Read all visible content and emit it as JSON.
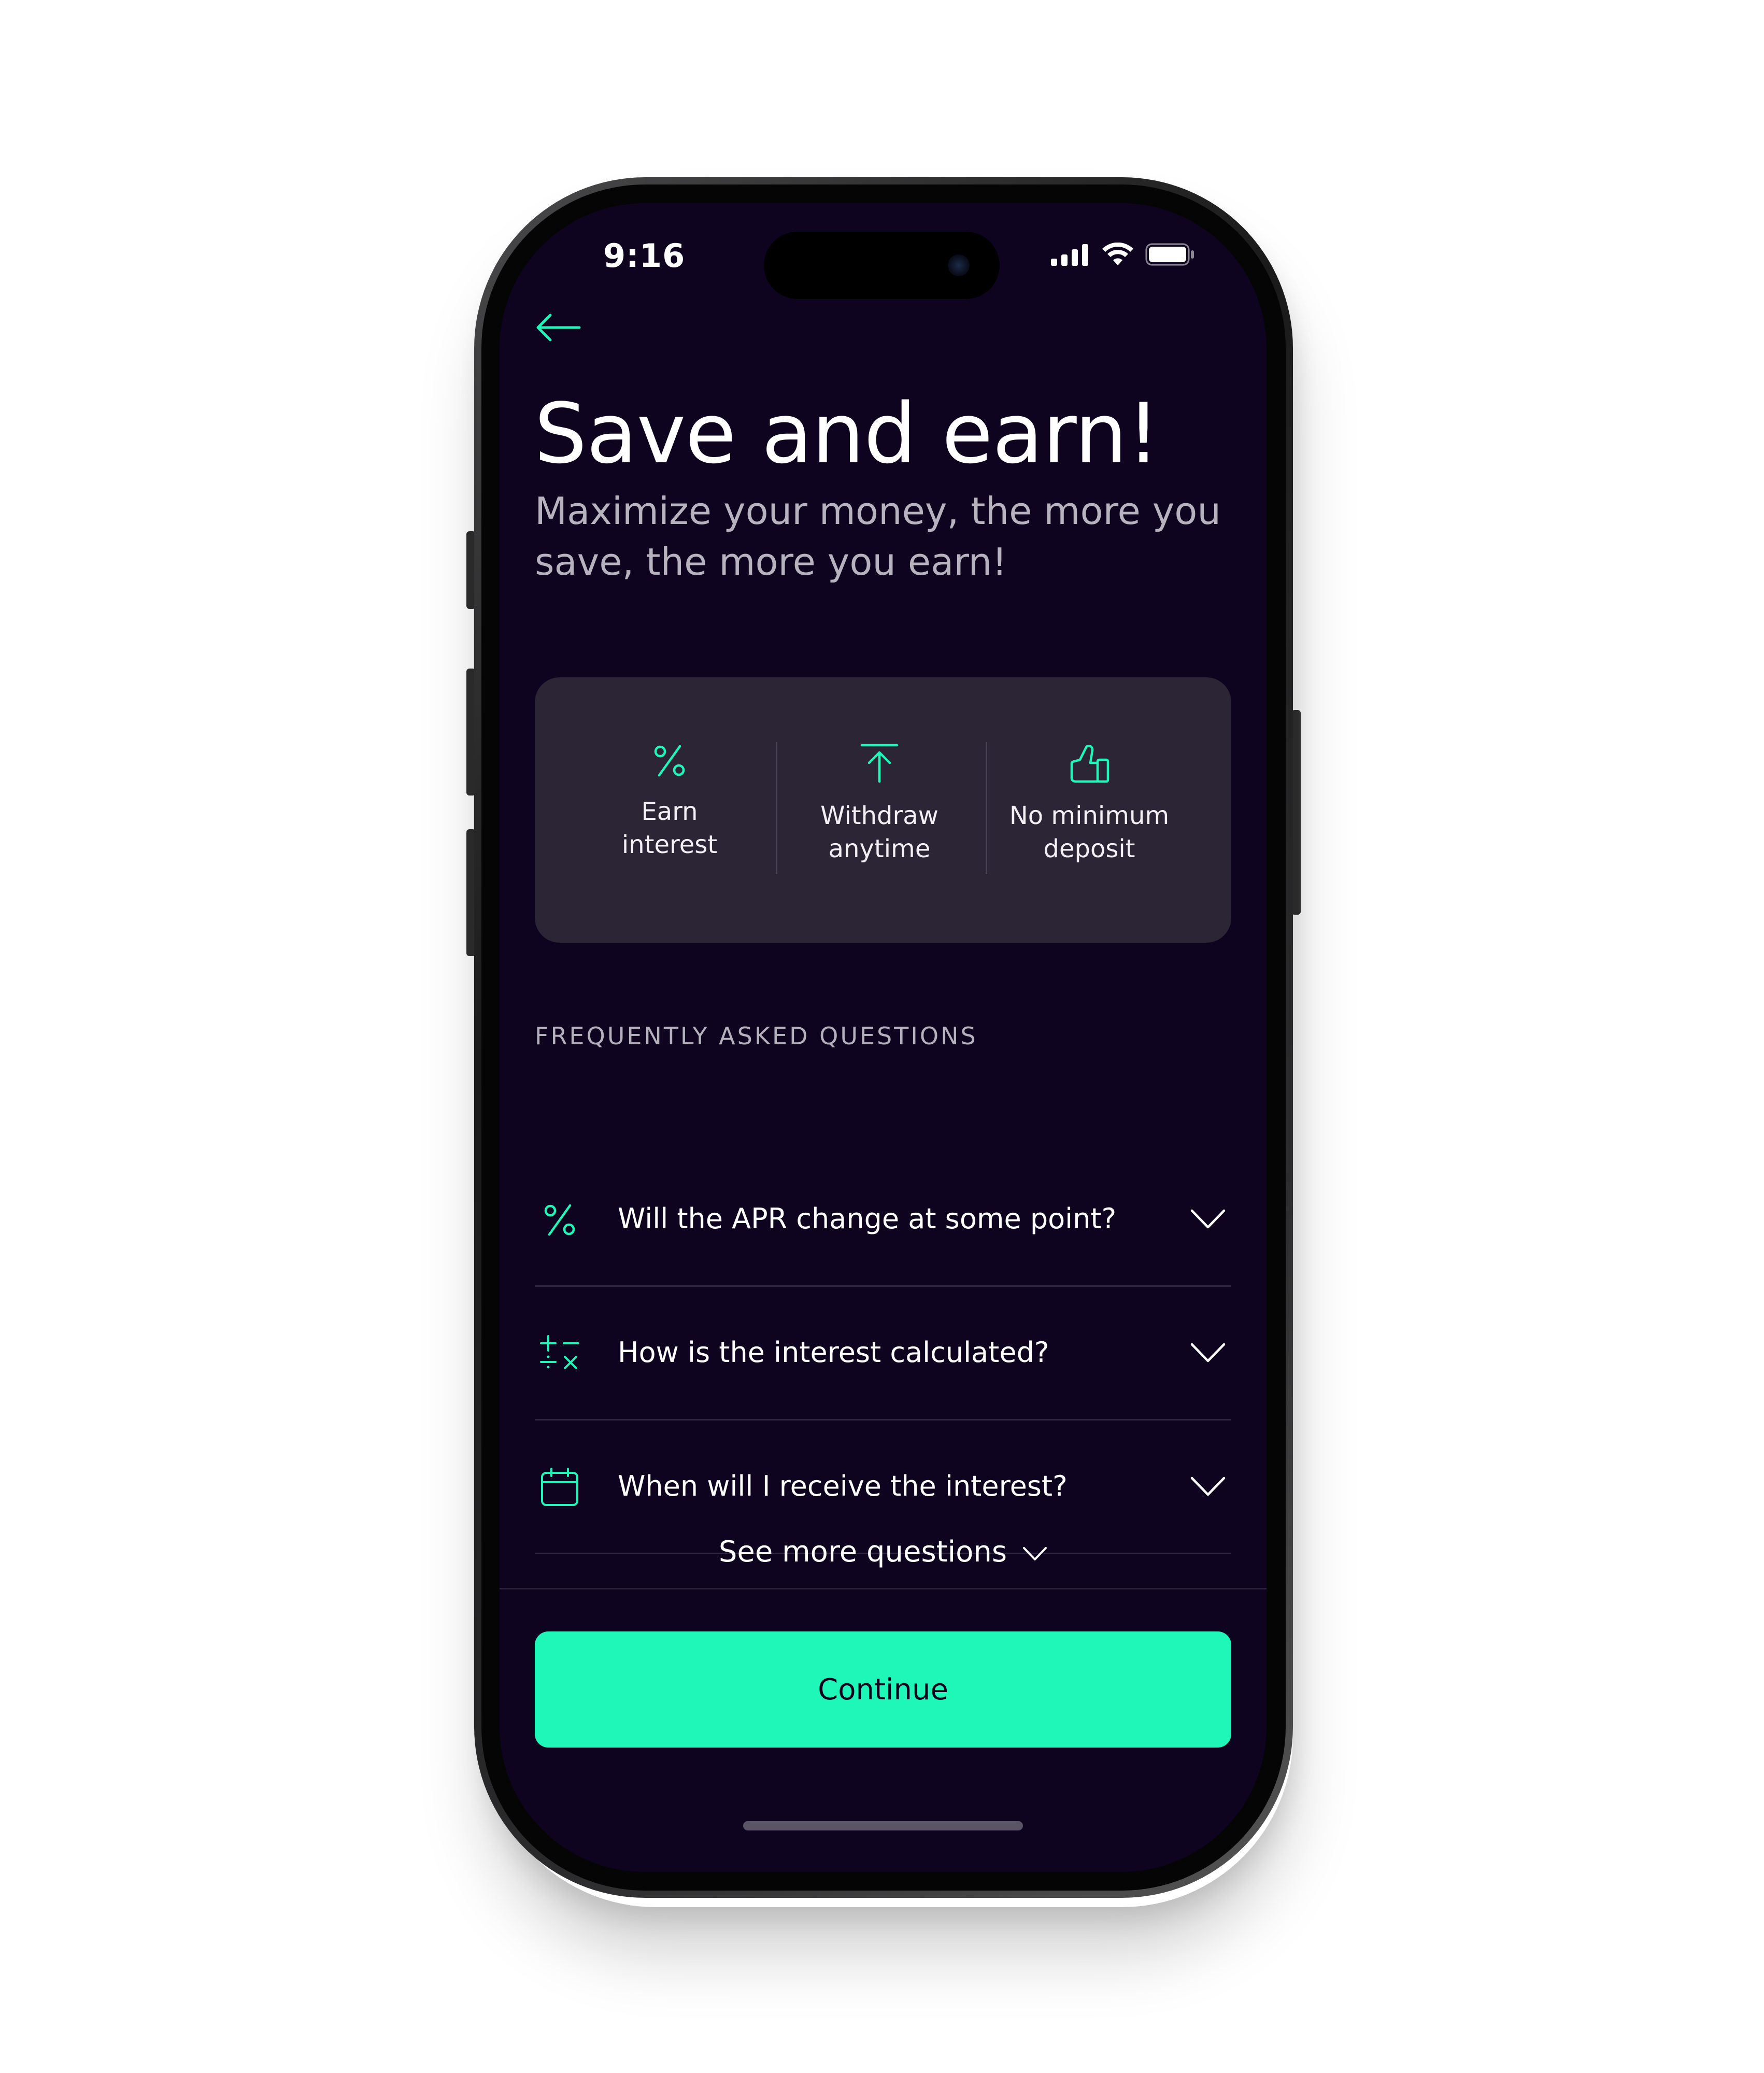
{
  "status_bar": {
    "time": "9:16",
    "icons": [
      "cellular-signal-icon",
      "wifi-icon",
      "battery-icon"
    ]
  },
  "header": {
    "back_icon": "arrow-left-icon"
  },
  "hero": {
    "title": "Save and earn!",
    "subtitle": "Maximize your money, the more you save, the more you earn!"
  },
  "features": [
    {
      "icon": "percent-icon",
      "line1": "Earn",
      "line2": "interest"
    },
    {
      "icon": "withdraw-upload-icon",
      "line1": "Withdraw",
      "line2": "anytime"
    },
    {
      "icon": "thumbs-up-icon",
      "line1": "No minimum",
      "line2": "deposit"
    }
  ],
  "faq": {
    "heading": "FREQUENTLY ASKED QUESTIONS",
    "items": [
      {
        "icon": "percent-icon",
        "question": "Will the APR change at some point?"
      },
      {
        "icon": "calculator-icon",
        "question": "How is the interest calculated?"
      },
      {
        "icon": "calendar-icon",
        "question": "When will I receive the interest?"
      }
    ],
    "see_more_label": "See more questions"
  },
  "footer": {
    "continue_label": "Continue"
  },
  "colors": {
    "background": "#0e0420",
    "accent": "#1ff7b8",
    "card": "#2b2536",
    "muted_text": "#b6b2be"
  }
}
